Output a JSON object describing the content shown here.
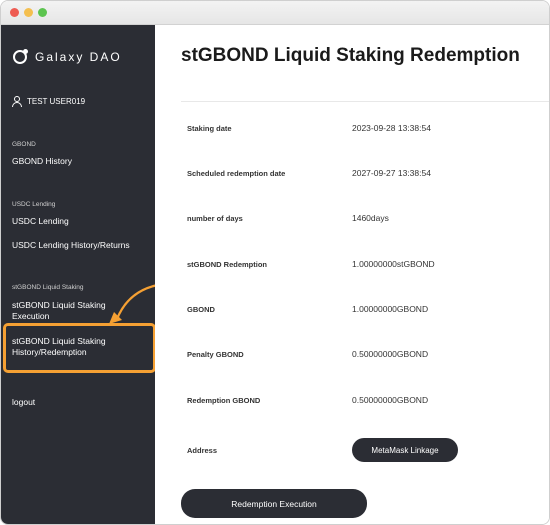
{
  "brand": {
    "name": "Galaxy DAO"
  },
  "user": {
    "name": "TEST USER019"
  },
  "sidebar": {
    "sections": [
      {
        "label": "GBOND",
        "items": [
          "GBOND History"
        ]
      },
      {
        "label": "USDC Lending",
        "items": [
          "USDC Lending",
          "USDC Lending History/Returns"
        ]
      },
      {
        "label": "stGBOND Liquid Staking",
        "items": [
          "stGBOND Liquid Staking Execution",
          "stGBOND Liquid Staking History/Redemption"
        ]
      }
    ],
    "logout": "logout",
    "active_item": "stGBOND Liquid Staking History/Redemption"
  },
  "main": {
    "title": "stGBOND Liquid Staking Redemption",
    "rows": [
      {
        "label": "Staking date",
        "value": "2023-09-28 13:38:54"
      },
      {
        "label": "Scheduled redemption date",
        "value": "2027-09-27 13:38:54"
      },
      {
        "label": "number of days",
        "value": "1460days"
      },
      {
        "label": "stGBOND Redemption",
        "value": "1.00000000stGBOND"
      },
      {
        "label": "GBOND",
        "value": "1.00000000GBOND"
      },
      {
        "label": "Penalty GBOND",
        "value": "0.50000000GBOND"
      },
      {
        "label": "Redemption GBOND",
        "value": "0.50000000GBOND"
      },
      {
        "label": "Address",
        "value": ""
      }
    ],
    "metamask_button": "MetaMask Linkage",
    "redeem_button": "Redemption Execution"
  },
  "colors": {
    "sidebar_bg": "#2b2d34",
    "highlight": "#f5a033",
    "button_bg": "#2b2d34"
  }
}
